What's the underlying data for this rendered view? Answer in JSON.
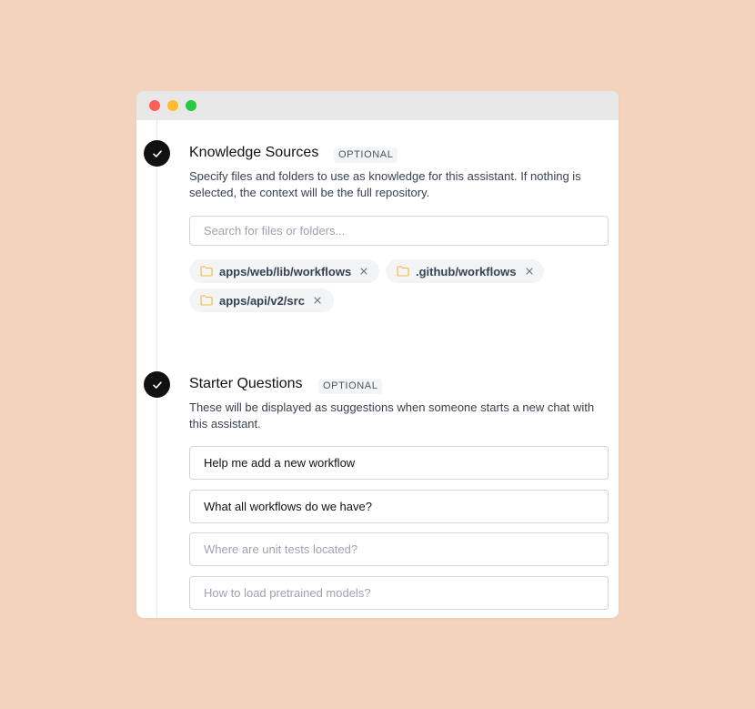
{
  "window": {
    "traffic_lights": [
      "close",
      "minimize",
      "zoom"
    ]
  },
  "knowledge": {
    "title": "Knowledge Sources",
    "badge": "OPTIONAL",
    "description": "Specify files and folders to use as knowledge for this assistant. If nothing is selected, the context will be the full repository.",
    "search_placeholder": "Search for files or folders...",
    "search_value": "",
    "chips": [
      {
        "label": "apps/web/lib/workflows",
        "icon": "folder-icon"
      },
      {
        "label": ".github/workflows",
        "icon": "folder-icon"
      },
      {
        "label": "apps/api/v2/src",
        "icon": "folder-icon"
      }
    ]
  },
  "starter": {
    "title": "Starter Questions",
    "badge": "OPTIONAL",
    "description": "These will be displayed as suggestions when someone starts a new chat with this assistant.",
    "questions": [
      {
        "value": "Help me add a new workflow",
        "placeholder": ""
      },
      {
        "value": "What all workflows do we have?",
        "placeholder": ""
      },
      {
        "value": "",
        "placeholder": "Where are unit tests located?"
      },
      {
        "value": "",
        "placeholder": "How to load pretrained models?"
      }
    ]
  },
  "colors": {
    "background": "#f3d2be",
    "folder_icon": "#f5b73b",
    "step_check": "#111111"
  }
}
